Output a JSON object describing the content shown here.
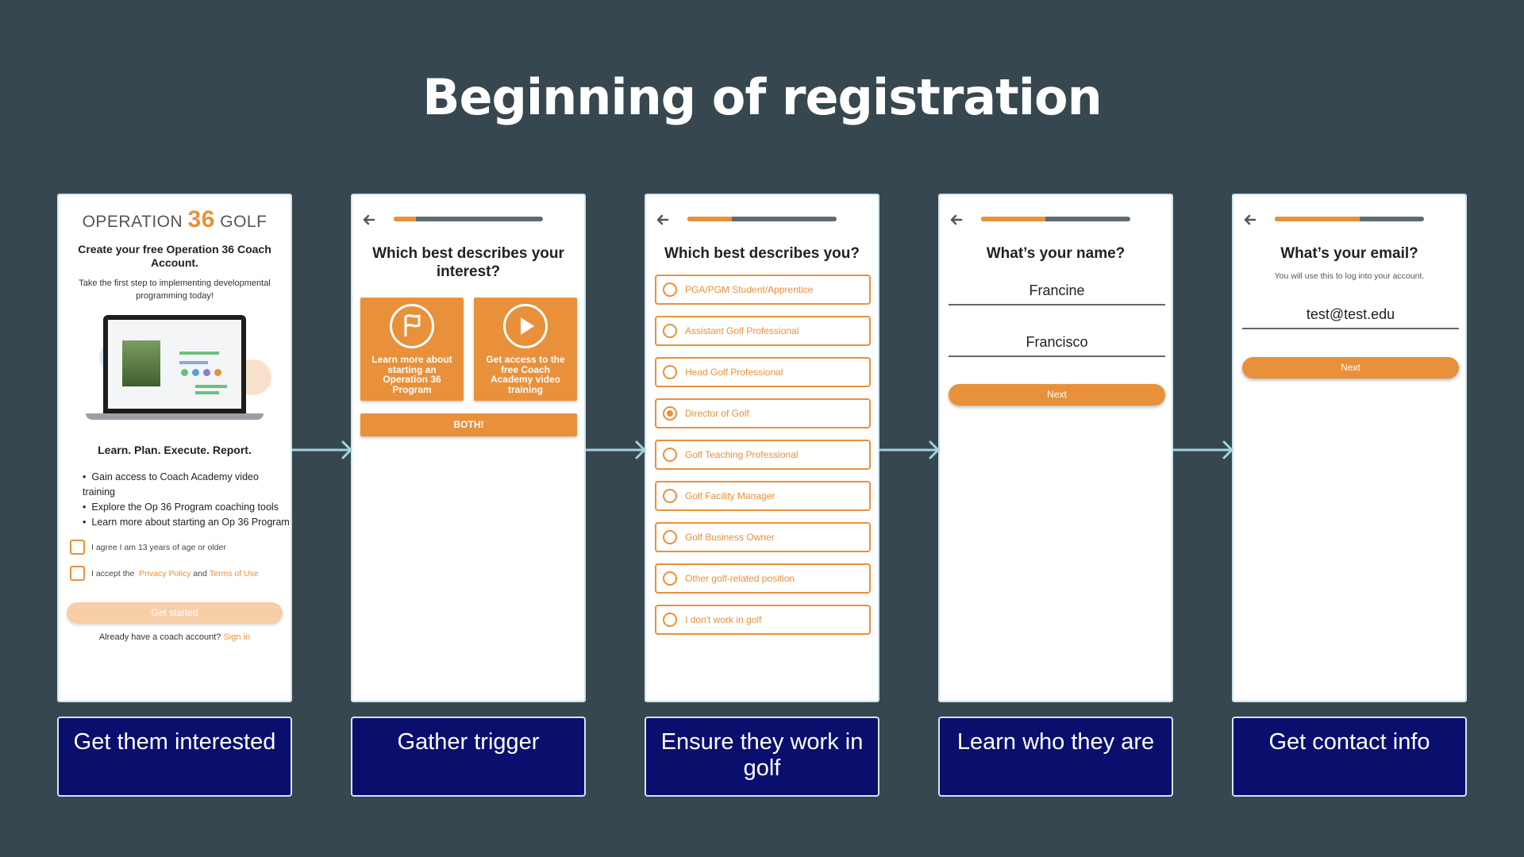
{
  "page": {
    "title": "Beginning of registration"
  },
  "colors": {
    "background": "#37474f",
    "accent": "#e8913a",
    "caption_bg": "#0a0f6e",
    "arrow": "#9fd3df"
  },
  "screen1": {
    "logo": {
      "left": "OPERATION",
      "number": "36",
      "right": "GOLF"
    },
    "title": "Create your free Operation 36 Coach Account.",
    "subtitle": "Take the first step to implementing developmental programming today!",
    "tagline": "Learn. Plan. Execute. Report.",
    "bullets": [
      "Gain access to Coach Academy video training",
      "Explore the Op 36 Program coaching tools",
      "Learn more about starting an Op 36 Program"
    ],
    "checkbox_age": "I agree I am 13 years of age or older",
    "checkbox_terms": {
      "prefix": "I accept the",
      "privacy": "Privacy Policy",
      "and": "and",
      "terms": "Terms of Use"
    },
    "button": "Get started",
    "signin": {
      "prefix": "Already have a coach account?",
      "link": "Sign in"
    }
  },
  "screen2": {
    "progress": 0.15,
    "question": "Which best describes your interest?",
    "cards": [
      {
        "icon": "flag-icon",
        "label": "Learn more about starting an Operation 36 Program"
      },
      {
        "icon": "play-icon",
        "label": "Get access to the free Coach Academy video training"
      }
    ],
    "both_button": "BOTH!"
  },
  "screen3": {
    "progress": 0.3,
    "question": "Which best describes you?",
    "options": [
      "PGA/PGM Student/Apprentice",
      "Assistant Golf Professional",
      "Head Golf Professional",
      "Director of Golf",
      "Golf Teaching Professional",
      "Golf Facility Manager",
      "Golf Business Owner",
      "Other golf-related position",
      "I don't work in golf"
    ],
    "selected": "Director of Golf"
  },
  "screen4": {
    "progress": 0.43,
    "question": "What’s your name?",
    "first_name": "Francine",
    "last_name": "Francisco",
    "button": "Next"
  },
  "screen5": {
    "progress": 0.57,
    "question": "What’s your email?",
    "hint": "You will use this to log into your account.",
    "email": "test@test.edu",
    "button": "Next"
  },
  "captions": [
    "Get them interested",
    "Gather trigger",
    "Ensure they work in golf",
    "Learn who they are",
    "Get contact info"
  ]
}
